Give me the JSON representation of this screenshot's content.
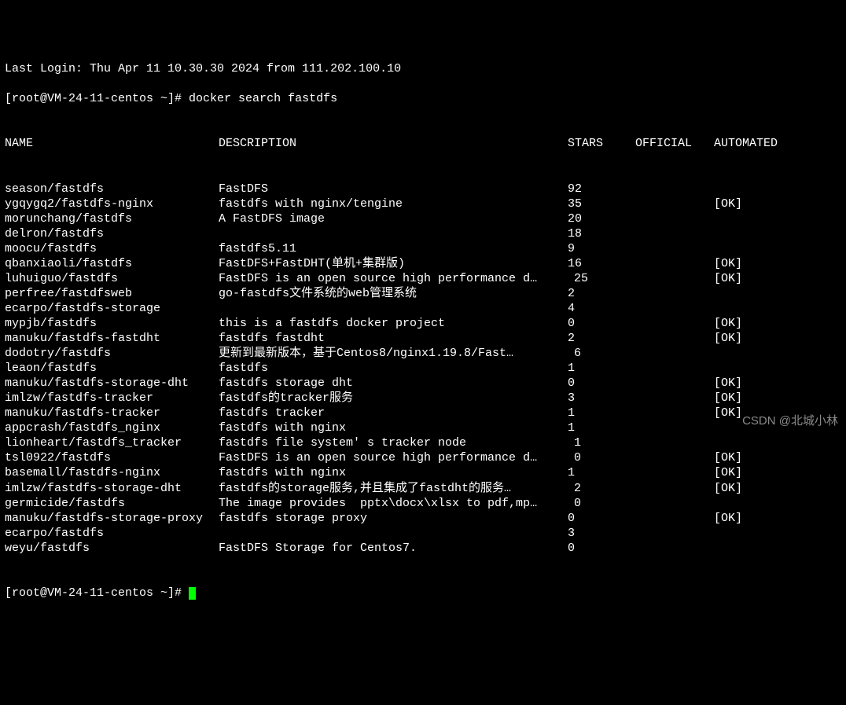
{
  "login_line": "Last Login: Thu Apr 11 10.30.30 2024 from 111.202.100.10",
  "prompt": "[root@VM-24-11-centos ~]# ",
  "command": "docker search fastdfs",
  "headers": {
    "name": "NAME",
    "description": "DESCRIPTION",
    "stars": "STARS",
    "official": "OFFICIAL",
    "automated": "AUTOMATED"
  },
  "rows": [
    {
      "name": "season/fastdfs",
      "description": "FastDFS",
      "stars": "92",
      "pad": false,
      "automated": ""
    },
    {
      "name": "ygqygq2/fastdfs-nginx",
      "description": "fastdfs with nginx/tengine",
      "stars": "35",
      "pad": false,
      "automated": "[OK]"
    },
    {
      "name": "morunchang/fastdfs",
      "description": "A FastDFS image",
      "stars": "20",
      "pad": false,
      "automated": ""
    },
    {
      "name": "delron/fastdfs",
      "description": "",
      "stars": "18",
      "pad": false,
      "automated": ""
    },
    {
      "name": "moocu/fastdfs",
      "description": "fastdfs5.11",
      "stars": "9",
      "pad": false,
      "automated": ""
    },
    {
      "name": "qbanxiaoli/fastdfs",
      "description": "FastDFS+FastDHT(单机+集群版)",
      "stars": "16",
      "pad": false,
      "automated": "[OK]"
    },
    {
      "name": "luhuiguo/fastdfs",
      "description": "FastDFS is an open source high performance d…",
      "stars": "25",
      "pad": true,
      "automated": "[OK]"
    },
    {
      "name": "perfree/fastdfsweb",
      "description": "go-fastdfs文件系统的web管理系统",
      "stars": "2",
      "pad": false,
      "automated": ""
    },
    {
      "name": "ecarpo/fastdfs-storage",
      "description": "",
      "stars": "4",
      "pad": false,
      "automated": ""
    },
    {
      "name": "mypjb/fastdfs",
      "description": "this is a fastdfs docker project",
      "stars": "0",
      "pad": false,
      "automated": "[OK]"
    },
    {
      "name": "manuku/fastdfs-fastdht",
      "description": "fastdfs fastdht",
      "stars": "2",
      "pad": false,
      "automated": "[OK]"
    },
    {
      "name": "dodotry/fastdfs",
      "description": "更新到最新版本，基于Centos8/nginx1.19.8/Fast…",
      "stars": "6",
      "pad": true,
      "automated": ""
    },
    {
      "name": "leaon/fastdfs",
      "description": "fastdfs",
      "stars": "1",
      "pad": false,
      "automated": ""
    },
    {
      "name": "manuku/fastdfs-storage-dht",
      "description": "fastdfs storage dht",
      "stars": "0",
      "pad": false,
      "automated": "[OK]"
    },
    {
      "name": "imlzw/fastdfs-tracker",
      "description": "fastdfs的tracker服务",
      "stars": "3",
      "pad": false,
      "automated": "[OK]"
    },
    {
      "name": "manuku/fastdfs-tracker",
      "description": "fastdfs tracker",
      "stars": "1",
      "pad": false,
      "automated": "[OK]"
    },
    {
      "name": "appcrash/fastdfs_nginx",
      "description": "fastdfs with nginx",
      "stars": "1",
      "pad": false,
      "automated": ""
    },
    {
      "name": "lionheart/fastdfs_tracker",
      "description": "fastdfs file system' s tracker node",
      "stars": "1",
      "pad": true,
      "automated": ""
    },
    {
      "name": "tsl0922/fastdfs",
      "description": "FastDFS is an open source high performance d…",
      "stars": "0",
      "pad": true,
      "automated": "[OK]"
    },
    {
      "name": "basemall/fastdfs-nginx",
      "description": "fastdfs with nginx",
      "stars": "1",
      "pad": false,
      "automated": "[OK]"
    },
    {
      "name": "imlzw/fastdfs-storage-dht",
      "description": "fastdfs的storage服务,并且集成了fastdht的服务…",
      "stars": "2",
      "pad": true,
      "automated": "[OK]"
    },
    {
      "name": "germicide/fastdfs",
      "description": "The image provides  pptx\\docx\\xlsx to pdf,mp…",
      "stars": "0",
      "pad": true,
      "automated": ""
    },
    {
      "name": "manuku/fastdfs-storage-proxy",
      "description": "fastdfs storage proxy",
      "stars": "0",
      "pad": false,
      "automated": "[OK]"
    },
    {
      "name": "ecarpo/fastdfs",
      "description": "",
      "stars": "3",
      "pad": false,
      "automated": ""
    },
    {
      "name": "weyu/fastdfs",
      "description": "FastDFS Storage for Centos7.",
      "stars": "0",
      "pad": false,
      "automated": ""
    }
  ],
  "watermark": "CSDN @北城小林"
}
